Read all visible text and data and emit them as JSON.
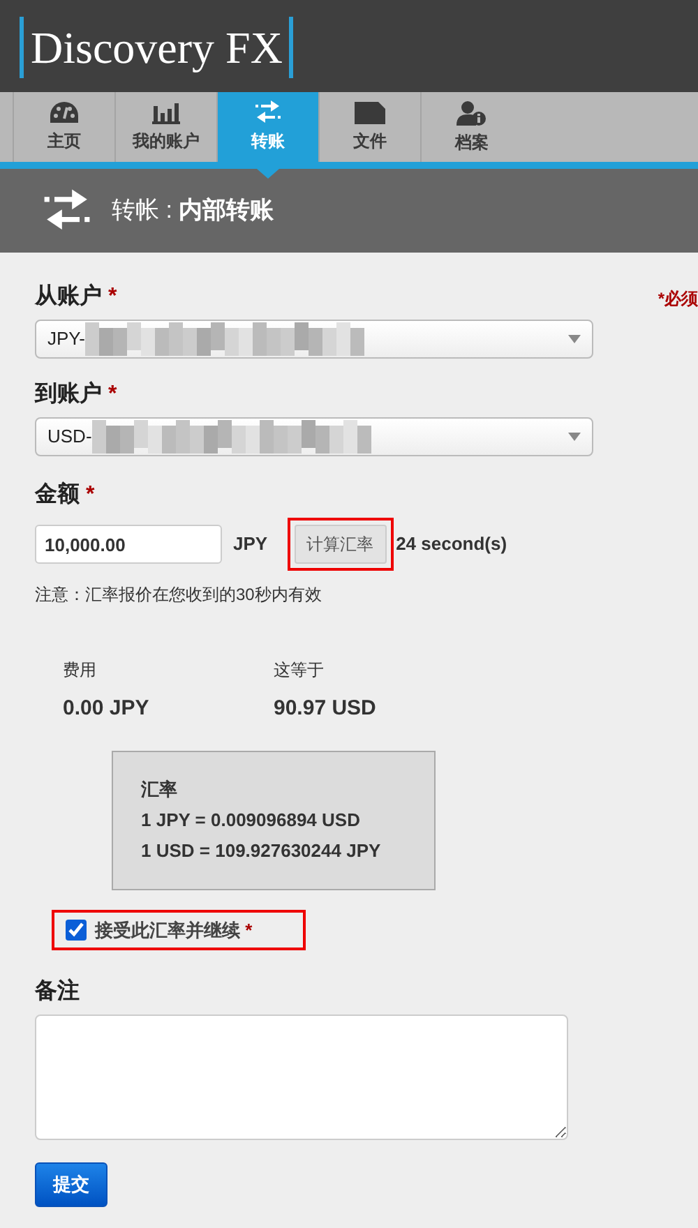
{
  "logo": {
    "text": "Discovery FX"
  },
  "tabs": [
    {
      "label": "主页",
      "selected": false
    },
    {
      "label": "我的账户",
      "selected": false
    },
    {
      "label": "转账",
      "selected": true
    },
    {
      "label": "文件",
      "selected": false
    },
    {
      "label": "档案",
      "selected": false
    }
  ],
  "page_header": {
    "prefix": "转帐 : ",
    "title": "内部转账"
  },
  "required_note": "*必须",
  "from_account": {
    "label": "从账户",
    "required_mark": "*",
    "value": "JPY-"
  },
  "to_account": {
    "label": "到账户",
    "required_mark": "*",
    "value": "USD-"
  },
  "amount": {
    "label": "金额",
    "required_mark": "*",
    "value": "10,000.00",
    "currency": "JPY",
    "button": "计算汇率",
    "button_highlighted": true,
    "countdown": "24 second(s)"
  },
  "notice": "注意：汇率报价在您收到的30秒内有效",
  "fee": {
    "label": "费用",
    "value": "0.00 JPY"
  },
  "equivalent": {
    "label": "这等于",
    "value": "90.97 USD"
  },
  "rate_box": {
    "title": "汇率",
    "lines": [
      "1 JPY = 0.009096894 USD",
      "1 USD = 109.927630244 JPY"
    ]
  },
  "accept": {
    "label": "接受此汇率并继续",
    "required_mark": "*",
    "checked": true,
    "highlighted": true
  },
  "remarks": {
    "label": "备注"
  },
  "submit": "提交"
}
